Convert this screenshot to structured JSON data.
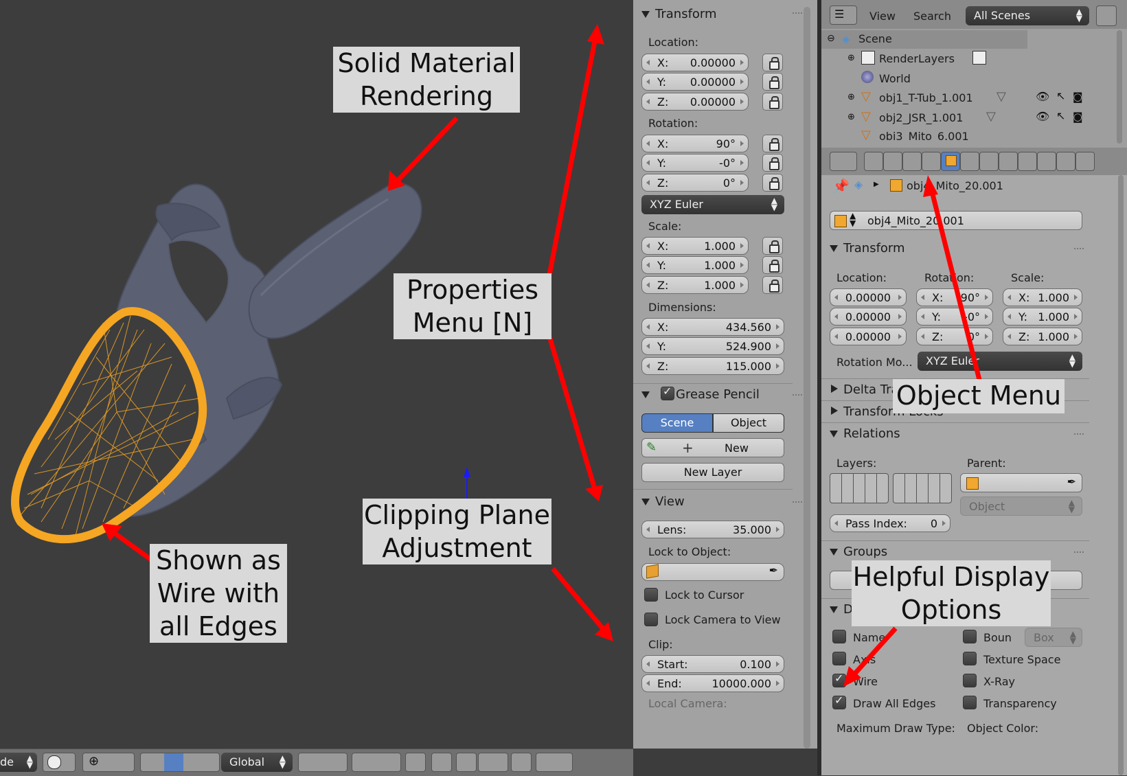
{
  "npanel": {
    "transform": {
      "title": "Transform",
      "location_label": "Location:",
      "location": [
        {
          "axis": "X:",
          "value": "0.00000"
        },
        {
          "axis": "Y:",
          "value": "0.00000"
        },
        {
          "axis": "Z:",
          "value": "0.00000"
        }
      ],
      "rotation_label": "Rotation:",
      "rotation": [
        {
          "axis": "X:",
          "value": "90°"
        },
        {
          "axis": "Y:",
          "value": "-0°"
        },
        {
          "axis": "Z:",
          "value": "0°"
        }
      ],
      "rotation_mode": "XYZ Euler",
      "scale_label": "Scale:",
      "scale": [
        {
          "axis": "X:",
          "value": "1.000"
        },
        {
          "axis": "Y:",
          "value": "1.000"
        },
        {
          "axis": "Z:",
          "value": "1.000"
        }
      ],
      "dimensions_label": "Dimensions:",
      "dimensions": [
        {
          "axis": "X:",
          "value": "434.560"
        },
        {
          "axis": "Y:",
          "value": "524.900"
        },
        {
          "axis": "Z:",
          "value": "115.000"
        }
      ]
    },
    "grease_pencil": {
      "title": "Grease Pencil",
      "tab_scene": "Scene",
      "tab_object": "Object",
      "new_label": "New",
      "new_layer_label": "New Layer"
    },
    "view": {
      "title": "View",
      "lens_label": "Lens:",
      "lens_value": "35.000",
      "lock_to_object_label": "Lock to Object:",
      "lock_to_cursor": "Lock to Cursor",
      "lock_camera_to_view": "Lock Camera to View",
      "clip_label": "Clip:",
      "clip_start_label": "Start:",
      "clip_start_value": "0.100",
      "clip_end_label": "End:",
      "clip_end_value": "10000.000",
      "local_camera_label": "Local Camera:"
    }
  },
  "outliner": {
    "view_menu": "View",
    "search_menu": "Search",
    "scene_filter": "All Scenes",
    "items": [
      {
        "label": "Scene"
      },
      {
        "label": "RenderLayers"
      },
      {
        "label": "World"
      },
      {
        "label": "obj1_T-Tub_1.001"
      },
      {
        "label": "obj2_JSR_1.001"
      },
      {
        "label": "obj3_Mito_6.001"
      }
    ]
  },
  "properties": {
    "breadcrumb_object": "obj4_Mito_20.001",
    "object_name": "obj4_Mito_20.001",
    "transform": {
      "title": "Transform",
      "location_label": "Location:",
      "rotation_label": "Rotation:",
      "scale_label": "Scale:",
      "location": [
        "0.00000",
        "0.00000",
        "0.00000"
      ],
      "rotation": [
        {
          "axis": "X:",
          "value": "90°"
        },
        {
          "axis": "Y:",
          "value": "-0°"
        },
        {
          "axis": "Z:",
          "value": "0°"
        }
      ],
      "scale": [
        {
          "axis": "X:",
          "value": "1.000"
        },
        {
          "axis": "Y:",
          "value": "1.000"
        },
        {
          "axis": "Z:",
          "value": "1.000"
        }
      ],
      "rotation_mode_label": "Rotation Mo...",
      "rotation_mode": "XYZ Euler"
    },
    "delta_transform": "Delta Transform",
    "transform_locks": "Transform Locks",
    "relations": {
      "title": "Relations",
      "layers_label": "Layers:",
      "parent_label": "Parent:",
      "parent_type": "Object",
      "pass_index_label": "Pass Index:",
      "pass_index_value": "0"
    },
    "groups": "Groups",
    "display": {
      "title": "Display",
      "name": "Name",
      "axis": "Axis",
      "wire": "Wire",
      "draw_all_edges": "Draw All Edges",
      "bounds": "Boun",
      "bounds_type": "Box",
      "texture_space": "Texture Space",
      "xray": "X-Ray",
      "transparency": "Transparency",
      "max_draw_type_label": "Maximum Draw Type:",
      "object_color_label": "Object Color:"
    }
  },
  "bottombar": {
    "mode_partial": "de",
    "orientation": "Global"
  },
  "callouts": {
    "solid": "Solid Material Rendering",
    "properties": "Properties Menu [N]",
    "clipping": "Clipping Plane Adjustment",
    "wire": "Shown as Wire with all Edges",
    "object": "Object Menu",
    "display": "Helpful Display Options"
  },
  "colors": {
    "viewport_bg": "#3d3d3d",
    "mesh": "#5b6073",
    "selection": "#f5a623",
    "arrow": "#ff0000",
    "active_tab": "#5680c2"
  }
}
